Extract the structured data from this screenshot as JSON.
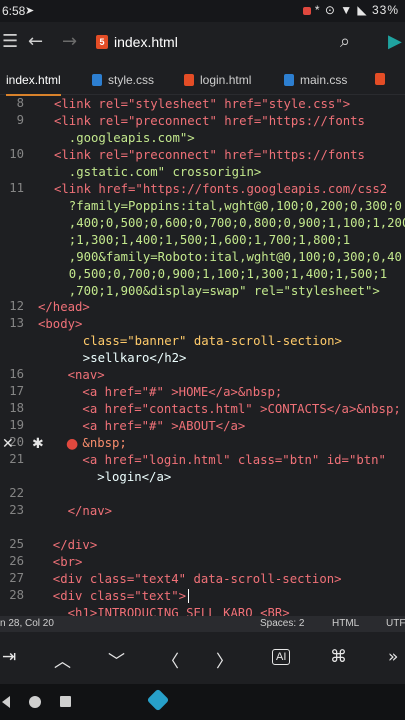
{
  "status_bar": {
    "time": "6:58",
    "right_icons": "* ⊙ ▼ ◣ 33%"
  },
  "toolbar": {
    "file_title": "index.html"
  },
  "tabs": [
    {
      "label": "index.html",
      "icon": "html-file-icon",
      "active": true
    },
    {
      "label": "style.css",
      "icon": "css-file-icon",
      "active": false
    },
    {
      "label": "login.html",
      "icon": "html-file-icon",
      "active": false
    },
    {
      "label": "main.css",
      "icon": "css-file-icon",
      "active": false
    }
  ],
  "gutter": [
    "8",
    "9",
    "",
    "10",
    "",
    "11",
    "",
    "",
    "",
    "",
    "",
    "12",
    "13",
    "",
    "",
    "16",
    "17",
    "18",
    "19",
    "20",
    "21",
    "",
    "22",
    "23",
    "",
    "25",
    "26",
    "27",
    "28"
  ],
  "code": {
    "l8": "<link rel=\"stylesheet\" href=\"style.css\">",
    "l9a": "<link rel=\"preconnect\" href=\"https://fonts",
    "l9b": "  .googleapis.com\">",
    "l10a": "<link rel=\"preconnect\" href=\"https://fonts",
    "l10b": "  .gstatic.com\" crossorigin>",
    "l11a": "<link href=\"https://fonts.googleapis.com/css2",
    "l11b": "  ?family=Poppins:ital,wght@0,100;0,200;0,300;0",
    "l11c": "  ,400;0,500;0,600;0,700;0,800;0,900;1,100;1,200",
    "l11d": "  ;1,300;1,400;1,500;1,600;1,700;1,800;1",
    "l11e": "  ,900&family=Roboto:ital,wght@0,100;0,300;0,40",
    "l11f": "  0,500;0,700;0,900;1,100;1,300;1,400;1,500;1",
    "l11g": "  ,700;1,900&display=swap\" rel=\"stylesheet\">",
    "l12": "</head>",
    "l13": "<body>",
    "l14": "  class=\"banner\" data-scroll-section>",
    "l15": "  >sellkaro</h2>",
    "l16": "    <nav>",
    "l17": "      <a href=\"#\" >HOME</a>&nbsp;",
    "l18": "      <a href=\"contacts.html\" >CONTACTS</a>&nbsp;",
    "l19": "      <a href=\"#\" >ABOUT</a>",
    "l20": "      &nbsp;",
    "l21a": "      <a href=\"login.html\" class=\"btn\" id=\"btn\"",
    "l21b": "        >login</a>",
    "l22": "",
    "l23": "    </nav>",
    "l24": "",
    "l25": "  </div>",
    "l26": "  <br>",
    "l27": "  <div class=\"text4\" data-scroll-section>",
    "l28": "  <div class=\"text\">",
    "l29": "    <h1>INTRODUCING SELL KARO <BR>"
  },
  "find_bar": {
    "close": "✕",
    "settings": "✱",
    "record": "●"
  },
  "editor_status": {
    "position": "n 28, Col 20",
    "spaces": "Spaces: 2",
    "language": "HTML",
    "encoding": "UTF"
  },
  "keys": {
    "tab": "⇥",
    "up": "︿",
    "down": "﹀",
    "left": "〈",
    "right": "〉",
    "ai": "AI",
    "cmd": "⌘",
    "more": "»"
  }
}
